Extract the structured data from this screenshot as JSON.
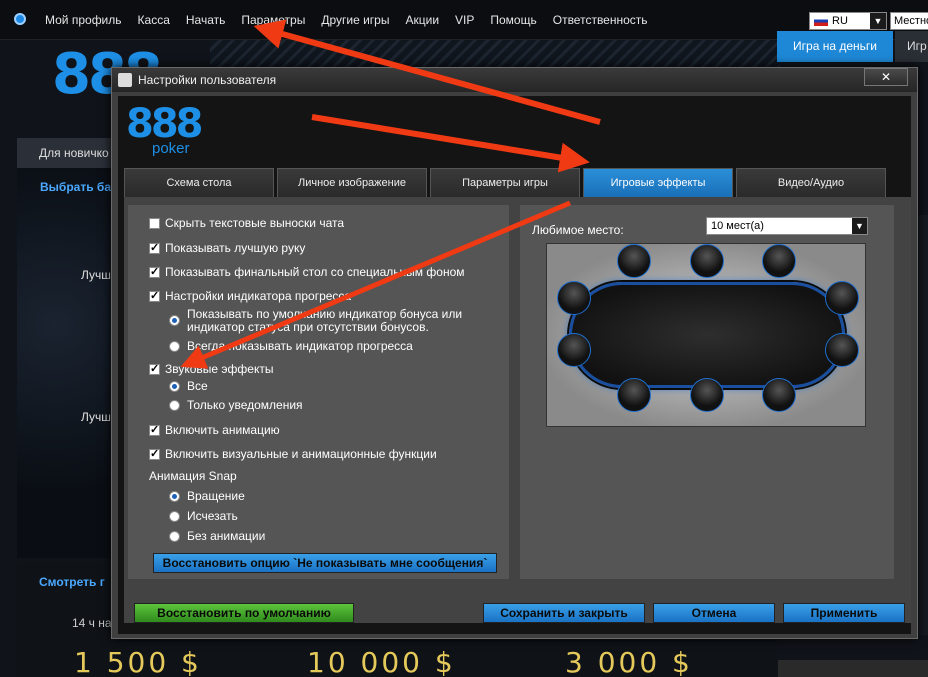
{
  "topbar": {
    "menu": [
      "Мой профиль",
      "Касса",
      "Начать",
      "Параметры",
      "Другие игры",
      "Акции",
      "VIP",
      "Помощь",
      "Ответственность"
    ],
    "language": "RU",
    "time_mode": "Местное"
  },
  "lobby": {
    "logo": "888",
    "logo_sub": "poker",
    "tab_money": "Игра на деньги",
    "tab_play": "Игр",
    "left_tab": "Для новичко",
    "left_select": "Выбрать ба",
    "left_best_1": "Лучш",
    "left_best_2": "Лучш",
    "watch_label": "Смотреть г",
    "hours_label": "14 ч на",
    "prizes": [
      "1 500 $",
      "10 000 $",
      "3 000 $"
    ]
  },
  "dialog": {
    "title": "Настройки пользователя",
    "close_label": "✕",
    "logo_num": "888",
    "logo_sub": "poker",
    "tabs": [
      {
        "label": "Схема стола",
        "active": false
      },
      {
        "label": "Личное изображение",
        "active": false
      },
      {
        "label": "Параметры игры",
        "active": false
      },
      {
        "label": "Игровые эффекты",
        "active": true
      },
      {
        "label": "Видео/Аудио",
        "active": false
      }
    ],
    "options": {
      "hide_chat": "Скрыть текстовые выноски чата",
      "show_best_hand": "Показывать лучшую руку",
      "show_final_table": "Показывать финальный стол со специальным фоном",
      "progress_settings": "Настройки индикатора прогресса",
      "progress_default": "Показывать по умолчанию индикатор бонуса или индикатор статуса при отсутствии бонусов.",
      "progress_always": "Всегда показывать индикатор прогресса",
      "sound_effects": "Звуковые эффекты",
      "sound_all": "Все",
      "sound_notifications": "Только уведомления",
      "enable_animation": "Включить анимацию",
      "enable_visual": "Включить визуальные и анимационные функции",
      "snap_label": "Анимация Snap",
      "snap_rotate": "Вращение",
      "snap_fade": "Исчезать",
      "snap_none": "Без анимации"
    },
    "restore_msg_button": "Восстановить опцию `Не показывать мне сообщения`",
    "favorite_seat_label": "Любимое место:",
    "favorite_seat_value": "10 мест(а)",
    "buttons": {
      "defaults": "Восстановить по умолчанию",
      "save_close": "Сохранить и закрыть",
      "cancel": "Отмена",
      "apply": "Применить"
    }
  },
  "colors": {
    "accent": "#1e88d6",
    "green": "#3f9f24",
    "arrow": "#f03a14"
  }
}
